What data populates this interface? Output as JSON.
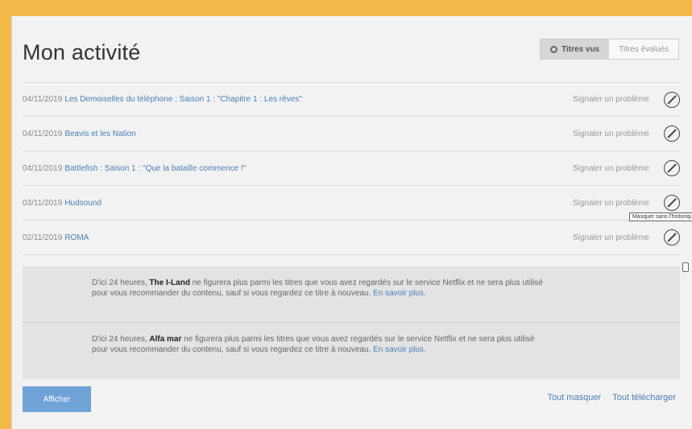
{
  "header": {
    "title": "Mon activité"
  },
  "toggle": {
    "watched_label": "Titres vus",
    "rated_label": "Titres évalués"
  },
  "rows": [
    {
      "date": "04/11/2019",
      "title": "Les Demoiselles du téléphone : Saison 1 : \"Chapitre 1 : Les rêves\"",
      "report": "Signaler un problème"
    },
    {
      "date": "04/11/2019",
      "title": "Beavis et les Nation",
      "report": "Signaler un problème"
    },
    {
      "date": "04/11/2019",
      "title": "Battlefish : Saison 1 : \"Que la bataille commence !\"",
      "report": "Signaler un problème"
    },
    {
      "date": "03/11/2019",
      "title": "Hudsound",
      "report": "Signaler un problème"
    },
    {
      "date": "02/11/2019",
      "title": "ROMA",
      "report": "Signaler un problème"
    }
  ],
  "tooltip": "Masquer sans l'historique",
  "notices": [
    {
      "prefix": "D'ici 24 heures, ",
      "name": "The I-Land",
      "suffix": " ne figurera plus parmi les titres que vous avez regardés sur le service Netflix et ne sera plus utilisé pour vous recommander du contenu, sauf si vous regardez ce titre à nouveau. ",
      "link": "En savoir plus."
    },
    {
      "prefix": "D'ici 24 heures, ",
      "name": "Alfa mar",
      "suffix": " ne figurera plus parmi les titres que vous avez regardés sur le service Netflix et ne sera plus utilisé pour vous recommander du contenu, sauf si vous regardez ce titre à nouveau. ",
      "link": "En savoir plus."
    }
  ],
  "footer": {
    "more_label": "Afficher",
    "hide_all": "Tout masquer",
    "download_all": "Tout télécharger"
  },
  "colors": {
    "link": "#4a7fb8",
    "button": "#6fa3d8",
    "frame": "#f5b94a"
  }
}
